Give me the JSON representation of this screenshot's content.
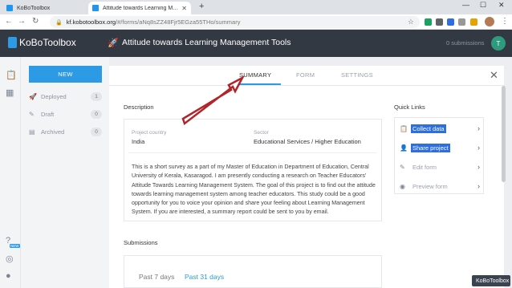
{
  "browser": {
    "tabs": [
      {
        "label": "KoBoToolbox",
        "active": false
      },
      {
        "label": "Attitude towards Learning Mana",
        "active": true
      }
    ],
    "url_host": "kf.kobotoolbox.org",
    "url_path": "/#/forms/aNq8sZZ48Fjr5EGza55THo/summary"
  },
  "header": {
    "logo": "KoBoToolbox",
    "project_title": "Attitude towards Learning Management Tools",
    "submissions_status": "0 submissions",
    "avatar_initial": "T"
  },
  "sidebar": {
    "new_label": "NEW",
    "items": [
      {
        "label": "Deployed",
        "count": "1"
      },
      {
        "label": "Draft",
        "count": "0"
      },
      {
        "label": "Archived",
        "count": "0"
      }
    ],
    "new_badge": "NEW"
  },
  "tabs": [
    "SUMMARY",
    "FORM",
    "SETTINGS"
  ],
  "description": {
    "heading": "Description",
    "country_label": "Project country",
    "country_value": "India",
    "sector_label": "Sector",
    "sector_value": "Educational Services / Higher Education",
    "text": "This is a short survey as a part of my Master of Education in Department of Education, Central University of Kerala, Kasaragod. I am presently conducting a research on Teacher Educators' Attitude Towards Learning Management System. The goal of this project is to find out the attitude towards learning management system among teacher educators. This study could be a good opportunity for you to voice your opinion and share your feeling about Learning Management System. If you are interested, a summary report could be sent to you by email."
  },
  "quick_links": {
    "heading": "Quick Links",
    "items": [
      {
        "label": "Collect data",
        "icon": "clipboard-icon"
      },
      {
        "label": "Share project",
        "icon": "add-user-icon"
      },
      {
        "label": "Edit form",
        "icon": "pencil-icon"
      },
      {
        "label": "Preview form",
        "icon": "eye-icon"
      }
    ]
  },
  "submissions": {
    "heading": "Submissions",
    "ranges": [
      "Past 7 days",
      "Past 31 days"
    ]
  },
  "watermark": "KoBoToolbox",
  "colors": {
    "accent": "#2d9ae6",
    "header_bg": "#333943",
    "arrow": "#b3242a"
  }
}
